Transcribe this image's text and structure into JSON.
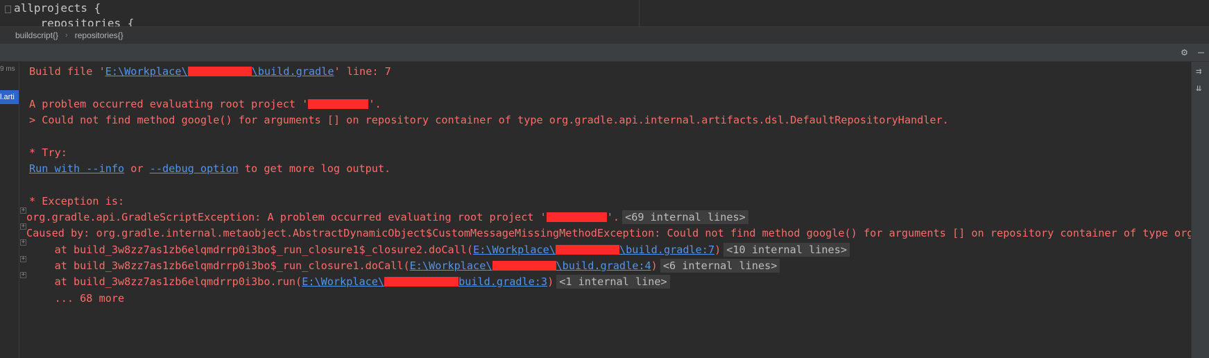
{
  "editor": {
    "line1": "allprojects {",
    "line2": "    repositories {"
  },
  "breadcrumb": {
    "items": [
      "buildscript{}",
      "repositories{}"
    ],
    "separator": "›"
  },
  "left_panel": {
    "time": "9 ms",
    "selected_item": "l.arti"
  },
  "console": {
    "line1": {
      "prefix": "Build file '",
      "link_a": "E:\\Workplace\\",
      "link_b": "\\build.gradle",
      "suffix": "' line: 7"
    },
    "line2": {
      "prefix": "A problem occurred evaluating root project '",
      "suffix": "'."
    },
    "line3": "> Could not find method google() for arguments [] on repository container of type org.gradle.api.internal.artifacts.dsl.DefaultRepositoryHandler.",
    "try_heading": "* Try:",
    "try_line": {
      "link1": "Run with --info",
      "or": " or ",
      "link2": "--debug option",
      "rest": " to get more log output."
    },
    "exception_heading": "* Exception is:",
    "ex1": {
      "text": "org.gradle.api.GradleScriptException: A problem occurred evaluating root project '",
      "end": "'.",
      "badge": "<69 internal lines>"
    },
    "ex2": "Caused by: org.gradle.internal.metaobject.AbstractDynamicObject$CustomMessageMissingMethodException: Could not find method google() for arguments [] on repository container of type org.gradle",
    "at1": {
      "text": "    at build_3w8zz7as1zb6elqmdrrp0i3bo$_run_closure1$_closure2.doCall(",
      "link_a": "E:\\Workplace\\",
      "link_b": "\\build.gradle:7",
      "end": ")",
      "badge": "<10 internal lines>"
    },
    "at2": {
      "text": "    at build_3w8zz7as1zb6elqmdrrp0i3bo$_run_closure1.doCall(",
      "link_a": "E:\\Workplace\\",
      "link_b": "\\build.gradle:4",
      "end": ")",
      "badge": "<6 internal lines>"
    },
    "at3": {
      "text": "    at build_3w8zz7as1zb6elqmdrrp0i3bo.run(",
      "link_a": "E:\\Workplace\\",
      "link_b": "build.gradle:3",
      "end": ")",
      "badge": "<1 internal line>"
    },
    "more": "    ... 68 more"
  },
  "colors": {
    "error_text": "#ff6b68",
    "link": "#5394ec",
    "redaction": "#ff2a2a",
    "background": "#2b2b2b"
  },
  "icons": {
    "header": [
      "gear-icon",
      "minimize-icon"
    ],
    "right_toolbar": [
      "soft-wrap-icon",
      "scroll-to-end-icon"
    ]
  }
}
